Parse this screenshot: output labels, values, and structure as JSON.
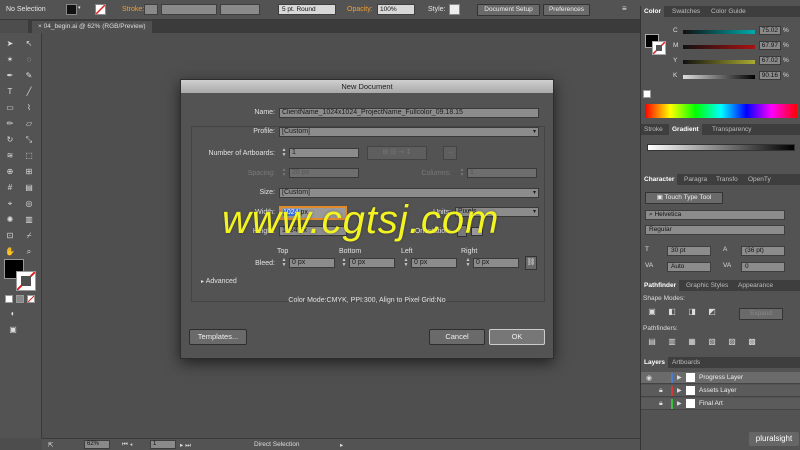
{
  "control_bar": {
    "selection": "No Selection",
    "stroke_label": "Stroke:",
    "brush": "5 pt. Round",
    "opacity_label": "Opacity:",
    "opacity_value": "100%",
    "style_label": "Style:",
    "document_setup": "Document Setup",
    "preferences": "Preferences"
  },
  "document_tab": "04_begin.ai @ 62% (RGB/Preview)",
  "status_bar": {
    "zoom": "62%",
    "artboard": "1",
    "tool": "Direct Selection"
  },
  "dialog": {
    "title": "New Document",
    "name_label": "Name:",
    "name_value": "ClientName_1024x1024_ProjectName_Fullcolor_09.18.15",
    "profile_label": "Profile:",
    "profile_value": "[Custom]",
    "artboards_label": "Number of Artboards:",
    "artboards_value": "1",
    "spacing_label": "Spacing:",
    "spacing_value": "20 px",
    "columns_label": "Columns:",
    "columns_value": "1",
    "size_label": "Size:",
    "size_value": "[Custom]",
    "width_label": "Width:",
    "width_value": "1024",
    "width_unit": "px",
    "units_label": "Units:",
    "units_value": "Pixels",
    "height_label": "Height:",
    "height_value": "1024 px",
    "orientation_label": "Orientation:",
    "bleed_label": "Bleed:",
    "bleed_top_label": "Top",
    "bleed_bottom_label": "Bottom",
    "bleed_left_label": "Left",
    "bleed_right_label": "Right",
    "bleed_top": "0 px",
    "bleed_bottom": "0 px",
    "bleed_left": "0 px",
    "bleed_right": "0 px",
    "advanced_label": "Advanced",
    "info": "Color Mode:CMYK, PPI:300, Align to Pixel Grid:No",
    "templates_button": "Templates...",
    "cancel_button": "Cancel",
    "ok_button": "OK"
  },
  "watermark": "www.cgtsj.com",
  "color_panel": {
    "tabs": [
      "Color",
      "Swatches",
      "Color Guide"
    ],
    "channels": [
      {
        "label": "C",
        "value": "75.02",
        "unit": "%"
      },
      {
        "label": "M",
        "value": "67.97",
        "unit": "%"
      },
      {
        "label": "Y",
        "value": "67.02",
        "unit": "%"
      },
      {
        "label": "K",
        "value": "90.16",
        "unit": "%"
      }
    ]
  },
  "gradient_tabs": [
    "Stroke",
    "Gradient",
    "Transparency"
  ],
  "character_panel": {
    "tabs": [
      "Character",
      "Paragra",
      "Transfo",
      "OpenTy"
    ],
    "touch_type_tool": "Touch Type Tool",
    "font": "Helvetica",
    "style": "Regular",
    "size": "30 pt",
    "leading": "(36 pt)",
    "kerning": "Auto",
    "tracking": "0"
  },
  "pathfinder_panel": {
    "tabs": [
      "Pathfinder",
      "Graphic Styles",
      "Appearance"
    ],
    "shape_modes": "Shape Modes:",
    "pathfinders": "Pathfinders:",
    "expand": "Expand"
  },
  "layers_panel": {
    "tabs": [
      "Layers",
      "Artboards"
    ],
    "layers": [
      {
        "name": "Progress Layer",
        "color": "#4a7bd6"
      },
      {
        "name": "Assets Layer",
        "color": "#d43a3a"
      },
      {
        "name": "Final Art",
        "color": "#3ac43a"
      }
    ]
  },
  "brand": "pluralsight",
  "colors": {
    "accent_yellow": "#f3f322",
    "dialog_bg": "#535353",
    "panel_bg": "#535353",
    "stroke_orange": "#f0a030"
  }
}
